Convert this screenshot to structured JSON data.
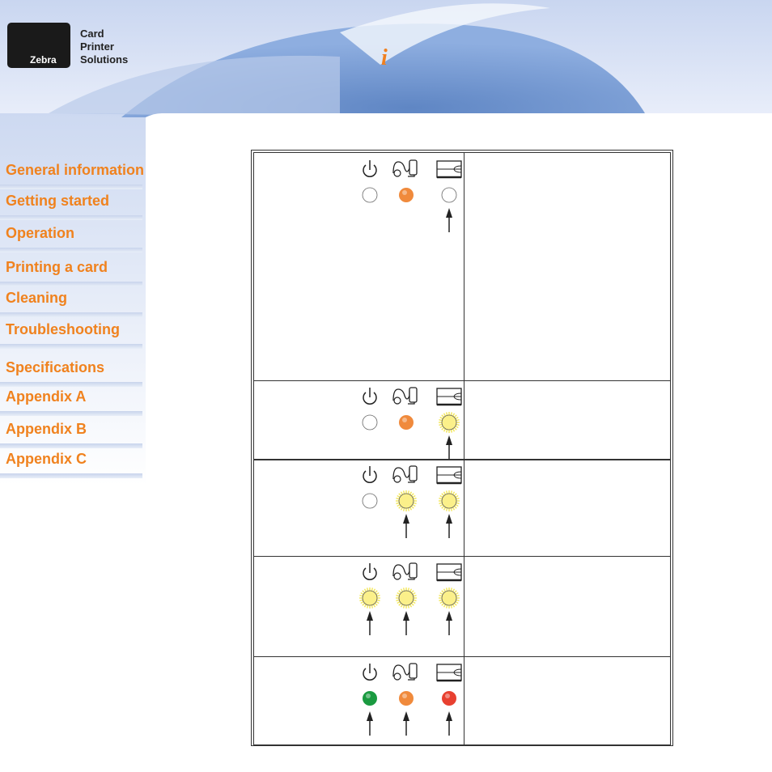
{
  "header": {
    "logo_text": "Zebra",
    "tagline": [
      "Card",
      "Printer",
      "Solutions"
    ],
    "info_icon": "i",
    "accent_color": "#f0821e"
  },
  "nav": {
    "items": [
      {
        "label": "General information"
      },
      {
        "label": "Getting started"
      },
      {
        "label": "Operation"
      },
      {
        "label": "Printing a card"
      },
      {
        "label": "Cleaning"
      },
      {
        "label": "Troubleshooting"
      },
      {
        "label": "Specifications"
      },
      {
        "label": "Appendix A"
      },
      {
        "label": "Appendix B"
      },
      {
        "label": "Appendix C"
      }
    ]
  },
  "led_table": {
    "icons": [
      "power-icon",
      "ribbon-card-icon",
      "card-feed-icon"
    ],
    "colors": {
      "off": "#ffffff",
      "orange": "#f08a3c",
      "yellow": "#fbf08a",
      "green": "#1a9a40",
      "red": "#e84030"
    },
    "rows": [
      {
        "leds": [
          "off",
          "orange",
          "off"
        ],
        "arrows": [
          false,
          false,
          true
        ]
      },
      {
        "leds": [
          "off",
          "orange",
          "yellow-flashing"
        ],
        "arrows": [
          false,
          false,
          true
        ]
      },
      {
        "leds": [
          "off",
          "yellow-flashing",
          "yellow-flashing"
        ],
        "arrows": [
          false,
          true,
          true
        ]
      },
      {
        "leds": [
          "yellow-flashing",
          "yellow-flashing",
          "yellow-flashing"
        ],
        "arrows": [
          true,
          true,
          true
        ]
      },
      {
        "leds": [
          "green",
          "orange",
          "red"
        ],
        "arrows": [
          true,
          true,
          true
        ]
      }
    ]
  }
}
